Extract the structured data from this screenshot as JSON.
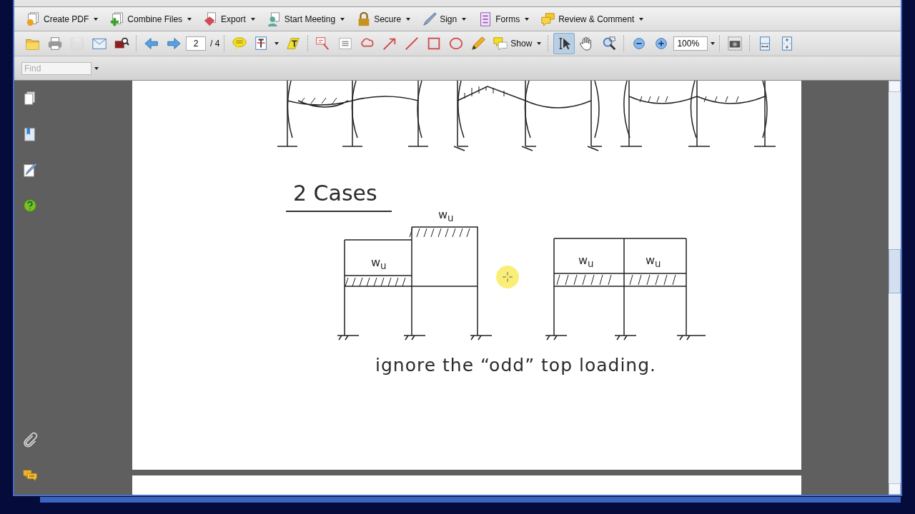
{
  "task_toolbar": [
    {
      "label": "Create PDF",
      "kind": "create"
    },
    {
      "label": "Combine Files",
      "kind": "combine"
    },
    {
      "label": "Export",
      "kind": "export"
    },
    {
      "label": "Start Meeting",
      "kind": "meeting"
    },
    {
      "label": "Secure",
      "kind": "secure"
    },
    {
      "label": "Sign",
      "kind": "sign"
    },
    {
      "label": "Forms",
      "kind": "forms"
    },
    {
      "label": "Review & Comment",
      "kind": "review"
    }
  ],
  "tools_toolbar": [
    [
      {
        "kind": "open",
        "selected": false,
        "disabled": false
      },
      {
        "kind": "print",
        "selected": false,
        "disabled": false
      },
      {
        "kind": "save",
        "selected": false,
        "disabled": true
      },
      {
        "kind": "email",
        "selected": false,
        "disabled": false
      },
      {
        "kind": "find_doc",
        "selected": false,
        "disabled": false
      }
    ],
    [
      {
        "kind": "prev",
        "selected": false,
        "disabled": false
      },
      {
        "kind": "next",
        "selected": false,
        "disabled": false
      },
      {
        "kind": "page_field",
        "value": "2",
        "total": "/ 4"
      }
    ],
    [
      {
        "kind": "comment",
        "selected": false,
        "disabled": false
      },
      {
        "kind": "text_edit",
        "selected": false,
        "disabled": false,
        "menu": true
      },
      {
        "kind": "highlight",
        "selected": false,
        "disabled": false
      }
    ],
    [
      {
        "kind": "callout",
        "selected": false,
        "disabled": false
      },
      {
        "kind": "lines",
        "selected": false,
        "disabled": false
      },
      {
        "kind": "cloud",
        "selected": false,
        "disabled": false
      },
      {
        "kind": "arrow",
        "selected": false,
        "disabled": false
      },
      {
        "kind": "line",
        "selected": false,
        "disabled": false
      },
      {
        "kind": "rect",
        "selected": false,
        "disabled": false
      },
      {
        "kind": "oval",
        "selected": false,
        "disabled": false
      },
      {
        "kind": "pencil",
        "selected": false,
        "disabled": false
      },
      {
        "kind": "show",
        "label": "Show",
        "selected": false,
        "disabled": false,
        "menu": true
      }
    ],
    [
      {
        "kind": "select",
        "selected": true,
        "disabled": false
      },
      {
        "kind": "hand",
        "selected": false,
        "disabled": false
      },
      {
        "kind": "marquee",
        "selected": false,
        "disabled": false
      }
    ],
    [
      {
        "kind": "zoom_out",
        "selected": false,
        "disabled": false
      },
      {
        "kind": "zoom_in",
        "selected": false,
        "disabled": false
      },
      {
        "kind": "zoom_field",
        "value": "100%"
      }
    ],
    [
      {
        "kind": "camera",
        "selected": false,
        "disabled": false
      }
    ],
    [
      {
        "kind": "fit_width",
        "selected": false,
        "disabled": false
      },
      {
        "kind": "fit_page",
        "selected": false,
        "disabled": false
      }
    ]
  ],
  "find": {
    "placeholder": "Find"
  },
  "nav_panel": {
    "top": [
      {
        "kind": "pages"
      },
      {
        "kind": "bookmarks"
      },
      {
        "kind": "signatures"
      },
      {
        "kind": "help"
      }
    ],
    "bottom": [
      {
        "kind": "attachments"
      },
      {
        "kind": "comments"
      }
    ]
  },
  "document": {
    "heading": "2 Cases",
    "load_labels": [
      "w$_{u}$",
      "w$_{u}$",
      "w$_{u}$",
      "w$_{u}$"
    ],
    "note": "ignore the “odd” top loading."
  }
}
